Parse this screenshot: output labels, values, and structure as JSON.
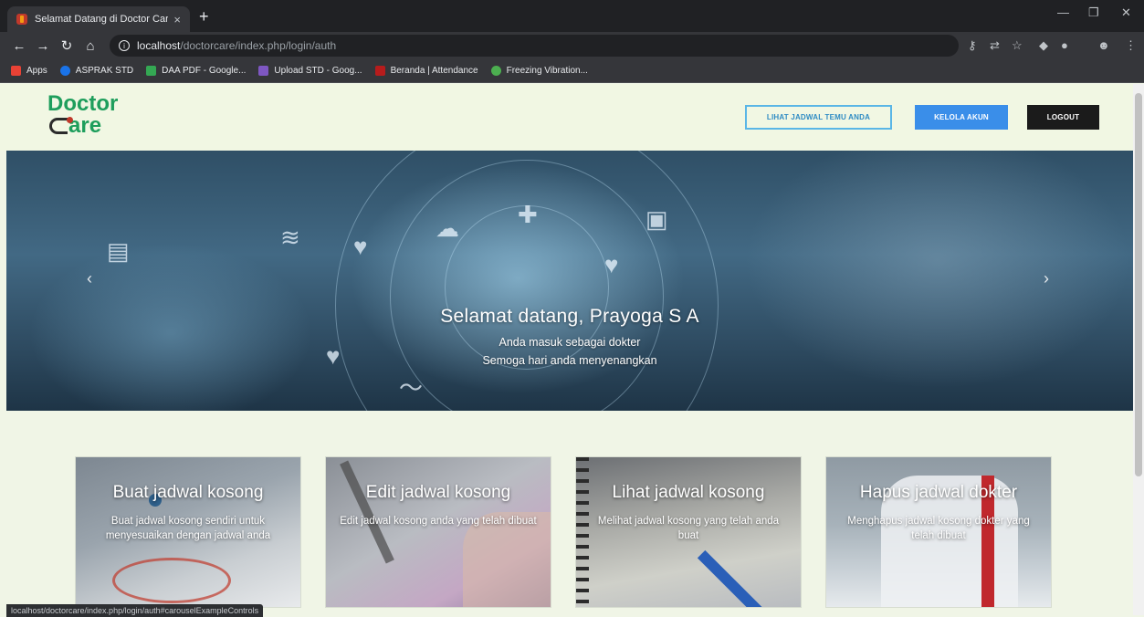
{
  "browser": {
    "tab_title": "Selamat Datang di Doctor Care",
    "tab_close": "×",
    "new_tab": "+",
    "url_host": "localhost",
    "url_path": "/doctorcare/index.php/login/auth",
    "bookmarks": [
      {
        "label": "Apps",
        "color": "#e94235"
      },
      {
        "label": "ASPRAK STD",
        "color": "#1a73e8"
      },
      {
        "label": "DAA PDF - Google...",
        "color": "#34a853"
      },
      {
        "label": "Upload STD - Goog...",
        "color": "#7e57c2"
      },
      {
        "label": "Beranda | Attendance",
        "color": "#b71c1c"
      },
      {
        "label": "Freezing Vibration...",
        "color": "#4caf50"
      }
    ],
    "status_url": "localhost/doctorcare/index.php/login/auth#carouselExampleControls"
  },
  "navbar": {
    "logo_line1": "Doctor",
    "logo_line2": "are",
    "btn_schedule": "LIHAT JADWAL TEMU ANDA",
    "btn_account": "KELOLA AKUN",
    "btn_logout": "LOGOUT",
    "colors": {
      "logo": "#1e9e5c",
      "outline": "#5ab6e6",
      "primary": "#3a8ee9",
      "dark": "#1b1b1b"
    }
  },
  "hero": {
    "title": "Selamat datang, Prayoga S A",
    "line1": "Anda masuk sebagai dokter",
    "line2": "Semoga hari anda menyenangkan",
    "prev": "‹",
    "next": "›"
  },
  "cards": [
    {
      "title": "Buat jadwal kosong",
      "desc": "Buat jadwal kosong sendiri untuk menyesuaikan dengan jadwal anda"
    },
    {
      "title": "Edit jadwal kosong",
      "desc": "Edit jadwal kosong anda yang telah dibuat"
    },
    {
      "title": "Lihat jadwal kosong",
      "desc": "Melihat jadwal kosong yang telah anda buat"
    },
    {
      "title": "Hapus jadwal dokter",
      "desc": "Menghapus jadwal kosong dokter yang telah dibuat"
    }
  ]
}
